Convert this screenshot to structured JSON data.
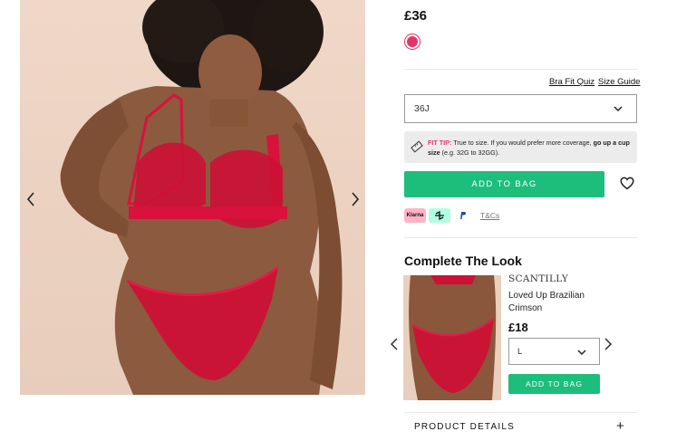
{
  "product": {
    "price": "£36",
    "swatch_color": "#e6336b",
    "links": {
      "fit_quiz": "Bra Fit Quiz",
      "size_guide": "Size Guide"
    },
    "size_selected": "36J",
    "fit_tip": {
      "label": "FIT TIP:",
      "text": " True to size. If you would prefer more coverage, ",
      "bold": "go up a cup size",
      "suffix": " (e.g. 32G to 32GG)."
    },
    "add_to_bag": "ADD TO BAG",
    "payments": {
      "klarna": "Klarna",
      "tcs": "T&Cs"
    }
  },
  "complete_the_look": {
    "title": "Complete The Look",
    "brand": "SCANTILLY",
    "name": "Loved Up Brazilian Crimson",
    "price": "£18",
    "size_selected": "L",
    "add_to_bag": "ADD TO BAG"
  },
  "details": {
    "label": "PRODUCT DETAILS",
    "toggle": "+"
  },
  "colors": {
    "accent_green": "#1dbd7c",
    "accent_pink": "#e6336b",
    "product_red": "#d8123a"
  },
  "icons": {
    "prev": "chevron-left-icon",
    "next": "chevron-right-icon",
    "wishlist": "heart-icon",
    "fit_tip": "tape-measure-icon",
    "dropdown": "chevron-down-icon"
  }
}
